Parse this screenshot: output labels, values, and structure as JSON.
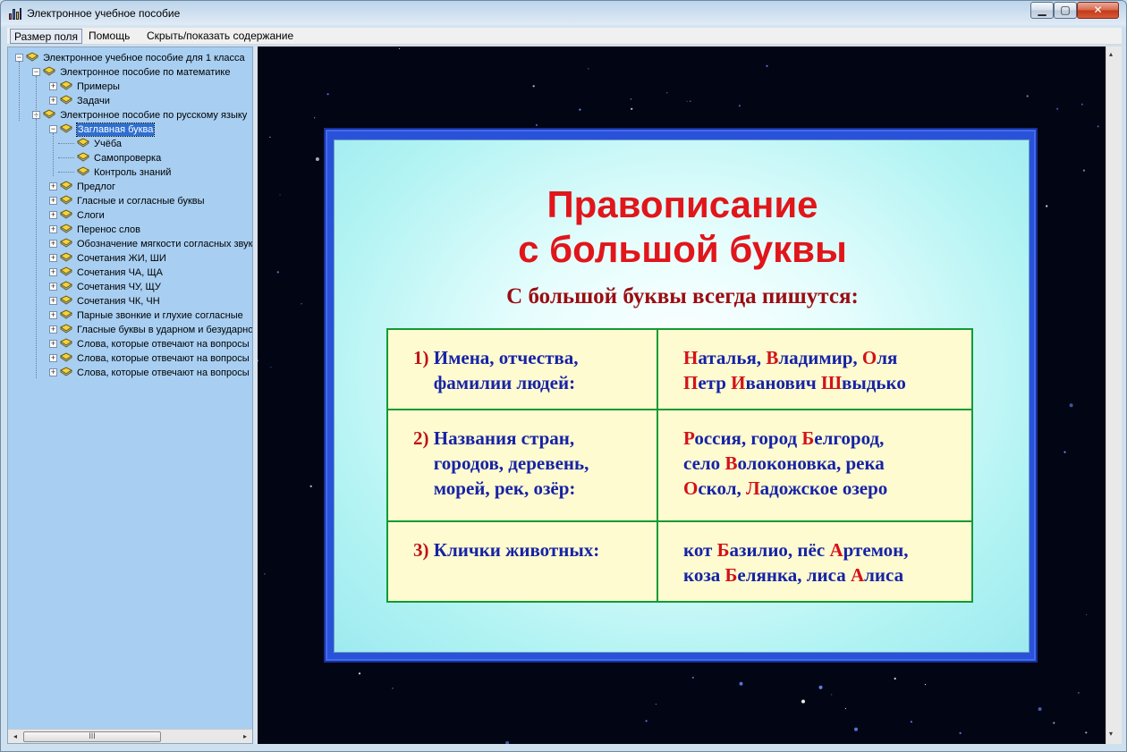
{
  "window": {
    "title": "Электронное учебное пособие",
    "controls": {
      "minimize": "▁",
      "maximize": "▢",
      "close": "✕"
    }
  },
  "menu": {
    "size": "Размер поля",
    "help": "Помощь",
    "toggle": "Скрыть/показать содержание"
  },
  "tree": {
    "nodes": [
      {
        "label": "Электронное учебное пособие для 1 класса",
        "expander": "−"
      },
      {
        "label": "Электронное пособие по математике",
        "expander": "−"
      },
      {
        "label": "Примеры",
        "expander": "+"
      },
      {
        "label": "Задачи",
        "expander": "+"
      },
      {
        "label": "Электронное пособие по русскому языку",
        "expander": "−"
      },
      {
        "label": "Заглавная буква",
        "expander": "−",
        "selected": true
      },
      {
        "label": "Учёба"
      },
      {
        "label": "Самопроверка"
      },
      {
        "label": "Контроль знаний"
      },
      {
        "label": "Предлог",
        "expander": "+"
      },
      {
        "label": "Гласные и согласные буквы",
        "expander": "+"
      },
      {
        "label": "Слоги",
        "expander": "+"
      },
      {
        "label": "Перенос слов",
        "expander": "+"
      },
      {
        "label": "Обозначение мягкости согласных звуков",
        "expander": "+"
      },
      {
        "label": "Сочетания ЖИ, ШИ",
        "expander": "+"
      },
      {
        "label": "Сочетания ЧА, ЩА",
        "expander": "+"
      },
      {
        "label": "Сочетания ЧУ, ЩУ",
        "expander": "+"
      },
      {
        "label": "Сочетания ЧК, ЧН",
        "expander": "+"
      },
      {
        "label": "Парные звонкие и глухие согласные",
        "expander": "+"
      },
      {
        "label": "Гласные буквы в ударном и безударном положении",
        "expander": "+"
      },
      {
        "label": "Слова, которые отвечают на вопросы кто? что?",
        "expander": "+"
      },
      {
        "label": "Слова, которые отвечают на вопросы что делать?",
        "expander": "+"
      },
      {
        "label": "Слова, которые отвечают на вопросы какой?",
        "expander": "+"
      }
    ]
  },
  "hscroll": {
    "thumb_grip": "III",
    "left": "◂",
    "right": "▸"
  },
  "vscroll": {
    "up": "▴",
    "down": "▾"
  },
  "slide": {
    "title_line1": "Правописание",
    "title_line2": "с большой буквы",
    "subtitle": "С большой буквы всегда пишутся:",
    "rows": [
      {
        "num": "1)",
        "category": [
          "Имена, отчества,",
          "фамилии людей:"
        ],
        "examples": [
          [
            [
              "Н",
              "аталья, "
            ],
            [
              "В",
              "ладимир, "
            ],
            [
              "О",
              "ля"
            ]
          ],
          [
            [
              "П",
              "етр "
            ],
            [
              "И",
              "ванович "
            ],
            [
              "Ш",
              "выдько"
            ]
          ]
        ]
      },
      {
        "num": "2)",
        "category": [
          "Названия  стран,",
          "городов, деревень,",
          "морей, рек, озёр:"
        ],
        "examples": [
          [
            [
              "Р",
              "оссия, город "
            ],
            [
              "Б",
              "елгород,"
            ]
          ],
          [
            [
              "",
              "село "
            ],
            [
              "В",
              "олоконовка, река"
            ]
          ],
          [
            [
              "О",
              "скол, "
            ],
            [
              "Л",
              "адожское озеро"
            ]
          ]
        ]
      },
      {
        "num": "3)",
        "category": [
          "Клички животных:"
        ],
        "examples": [
          [
            [
              "",
              "кот "
            ],
            [
              "Б",
              "азилио, пёс "
            ],
            [
              "А",
              "ртемон,"
            ]
          ],
          [
            [
              "",
              "коза "
            ],
            [
              "Б",
              "елянка, лиса "
            ],
            [
              "А",
              "лиса"
            ]
          ]
        ]
      }
    ]
  },
  "colors": {
    "sidebar_bg": "#a8cff2",
    "slide_frame": "#2a52d9",
    "title_red": "#e0161b",
    "text_blue": "#1623a6",
    "table_border": "#129a35",
    "table_bg": "#fffbd0"
  },
  "icons": {
    "app": "chart-bars-icon",
    "tree_node": "open-book-icon"
  }
}
